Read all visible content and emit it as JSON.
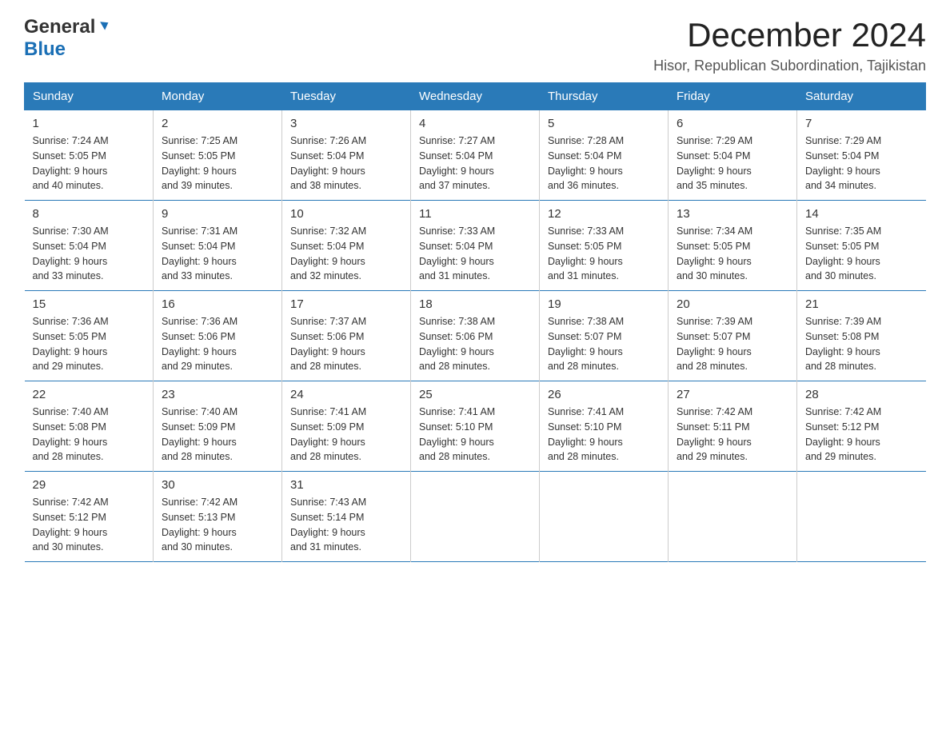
{
  "logo": {
    "general": "General",
    "blue": "Blue",
    "arrow": "▶"
  },
  "title": "December 2024",
  "location": "Hisor, Republican Subordination, Tajikistan",
  "days_header": [
    "Sunday",
    "Monday",
    "Tuesday",
    "Wednesday",
    "Thursday",
    "Friday",
    "Saturday"
  ],
  "weeks": [
    [
      {
        "day": "1",
        "sunrise": "7:24 AM",
        "sunset": "5:05 PM",
        "daylight": "9 hours and 40 minutes."
      },
      {
        "day": "2",
        "sunrise": "7:25 AM",
        "sunset": "5:05 PM",
        "daylight": "9 hours and 39 minutes."
      },
      {
        "day": "3",
        "sunrise": "7:26 AM",
        "sunset": "5:04 PM",
        "daylight": "9 hours and 38 minutes."
      },
      {
        "day": "4",
        "sunrise": "7:27 AM",
        "sunset": "5:04 PM",
        "daylight": "9 hours and 37 minutes."
      },
      {
        "day": "5",
        "sunrise": "7:28 AM",
        "sunset": "5:04 PM",
        "daylight": "9 hours and 36 minutes."
      },
      {
        "day": "6",
        "sunrise": "7:29 AM",
        "sunset": "5:04 PM",
        "daylight": "9 hours and 35 minutes."
      },
      {
        "day": "7",
        "sunrise": "7:29 AM",
        "sunset": "5:04 PM",
        "daylight": "9 hours and 34 minutes."
      }
    ],
    [
      {
        "day": "8",
        "sunrise": "7:30 AM",
        "sunset": "5:04 PM",
        "daylight": "9 hours and 33 minutes."
      },
      {
        "day": "9",
        "sunrise": "7:31 AM",
        "sunset": "5:04 PM",
        "daylight": "9 hours and 33 minutes."
      },
      {
        "day": "10",
        "sunrise": "7:32 AM",
        "sunset": "5:04 PM",
        "daylight": "9 hours and 32 minutes."
      },
      {
        "day": "11",
        "sunrise": "7:33 AM",
        "sunset": "5:04 PM",
        "daylight": "9 hours and 31 minutes."
      },
      {
        "day": "12",
        "sunrise": "7:33 AM",
        "sunset": "5:05 PM",
        "daylight": "9 hours and 31 minutes."
      },
      {
        "day": "13",
        "sunrise": "7:34 AM",
        "sunset": "5:05 PM",
        "daylight": "9 hours and 30 minutes."
      },
      {
        "day": "14",
        "sunrise": "7:35 AM",
        "sunset": "5:05 PM",
        "daylight": "9 hours and 30 minutes."
      }
    ],
    [
      {
        "day": "15",
        "sunrise": "7:36 AM",
        "sunset": "5:05 PM",
        "daylight": "9 hours and 29 minutes."
      },
      {
        "day": "16",
        "sunrise": "7:36 AM",
        "sunset": "5:06 PM",
        "daylight": "9 hours and 29 minutes."
      },
      {
        "day": "17",
        "sunrise": "7:37 AM",
        "sunset": "5:06 PM",
        "daylight": "9 hours and 28 minutes."
      },
      {
        "day": "18",
        "sunrise": "7:38 AM",
        "sunset": "5:06 PM",
        "daylight": "9 hours and 28 minutes."
      },
      {
        "day": "19",
        "sunrise": "7:38 AM",
        "sunset": "5:07 PM",
        "daylight": "9 hours and 28 minutes."
      },
      {
        "day": "20",
        "sunrise": "7:39 AM",
        "sunset": "5:07 PM",
        "daylight": "9 hours and 28 minutes."
      },
      {
        "day": "21",
        "sunrise": "7:39 AM",
        "sunset": "5:08 PM",
        "daylight": "9 hours and 28 minutes."
      }
    ],
    [
      {
        "day": "22",
        "sunrise": "7:40 AM",
        "sunset": "5:08 PM",
        "daylight": "9 hours and 28 minutes."
      },
      {
        "day": "23",
        "sunrise": "7:40 AM",
        "sunset": "5:09 PM",
        "daylight": "9 hours and 28 minutes."
      },
      {
        "day": "24",
        "sunrise": "7:41 AM",
        "sunset": "5:09 PM",
        "daylight": "9 hours and 28 minutes."
      },
      {
        "day": "25",
        "sunrise": "7:41 AM",
        "sunset": "5:10 PM",
        "daylight": "9 hours and 28 minutes."
      },
      {
        "day": "26",
        "sunrise": "7:41 AM",
        "sunset": "5:10 PM",
        "daylight": "9 hours and 28 minutes."
      },
      {
        "day": "27",
        "sunrise": "7:42 AM",
        "sunset": "5:11 PM",
        "daylight": "9 hours and 29 minutes."
      },
      {
        "day": "28",
        "sunrise": "7:42 AM",
        "sunset": "5:12 PM",
        "daylight": "9 hours and 29 minutes."
      }
    ],
    [
      {
        "day": "29",
        "sunrise": "7:42 AM",
        "sunset": "5:12 PM",
        "daylight": "9 hours and 30 minutes."
      },
      {
        "day": "30",
        "sunrise": "7:42 AM",
        "sunset": "5:13 PM",
        "daylight": "9 hours and 30 minutes."
      },
      {
        "day": "31",
        "sunrise": "7:43 AM",
        "sunset": "5:14 PM",
        "daylight": "9 hours and 31 minutes."
      },
      null,
      null,
      null,
      null
    ]
  ],
  "labels": {
    "sunrise": "Sunrise:",
    "sunset": "Sunset:",
    "daylight": "Daylight:"
  }
}
